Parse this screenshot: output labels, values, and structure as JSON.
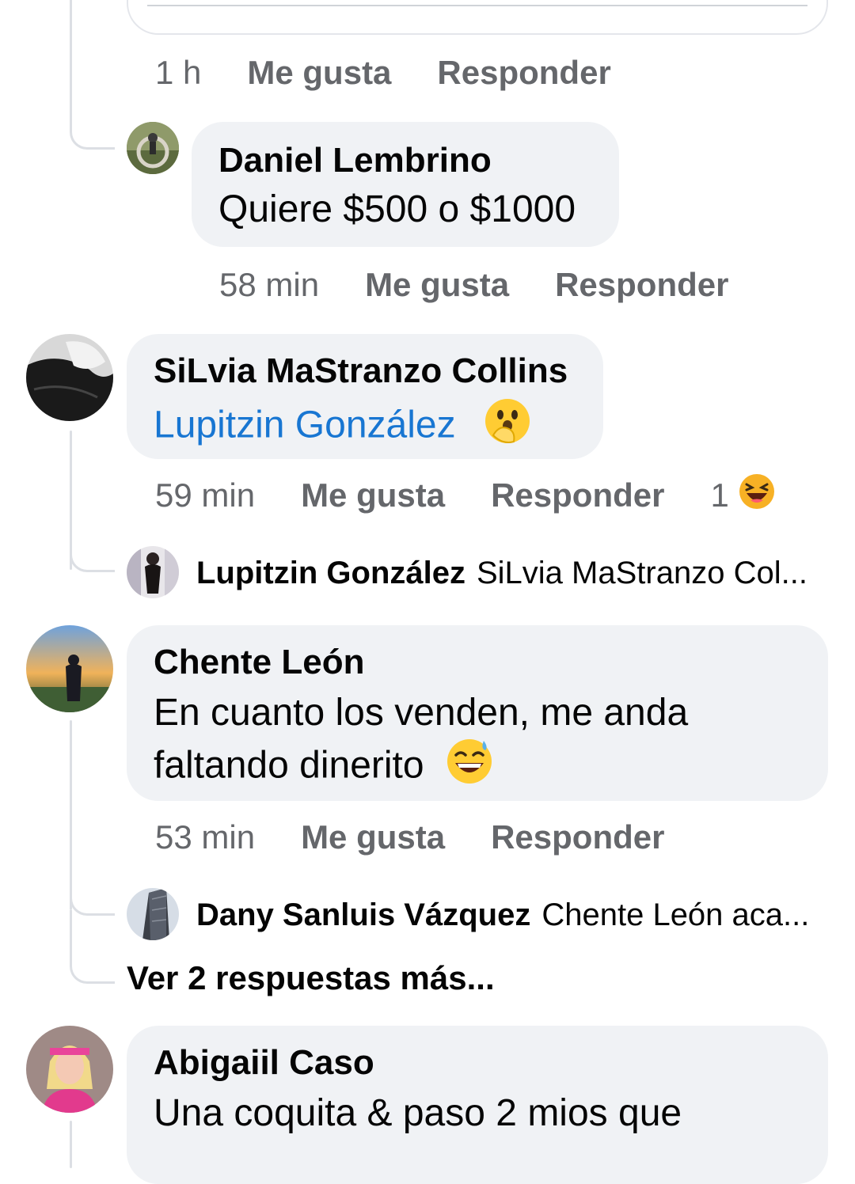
{
  "top_action_row": {
    "time": "1 h",
    "like": "Me gusta",
    "reply": "Responder"
  },
  "comments": [
    {
      "author": "Daniel Lembrino",
      "text": "Quiere $500 o $1000",
      "time": "58 min",
      "like": "Me gusta",
      "reply": "Responder",
      "avatar_icon": "person-avatar"
    },
    {
      "author": "SiLvia MaStranzo Collins",
      "mention": "Lupitzin González",
      "emoji_icon": "face-with-open-eyes-and-hand-over-mouth-icon",
      "time": "59 min",
      "like": "Me gusta",
      "reply": "Responder",
      "reaction_count": "1",
      "reaction_icon": "haha-reaction-icon",
      "avatar_icon": "person-avatar",
      "reply_preview": {
        "author": "Lupitzin González",
        "text": "SiLvia MaStranzo Col..."
      }
    },
    {
      "author": "Chente León",
      "text_line1": "En cuanto los venden, me anda",
      "text_line2": "faltando dinerito",
      "emoji_icon": "grinning-face-with-sweat-icon",
      "time": "53 min",
      "like": "Me gusta",
      "reply": "Responder",
      "avatar_icon": "person-avatar",
      "reply_preview": {
        "author": "Dany Sanluis Vázquez",
        "text": "Chente León aca..."
      },
      "more_replies": "Ver 2 respuestas más..."
    },
    {
      "author": "Abigaiil Caso",
      "text": "Una coquita & paso 2 mios que",
      "avatar_icon": "person-avatar"
    }
  ],
  "colors": {
    "bubble": "#f0f2f5",
    "meta_text": "#65676b",
    "mention": "#1876d2",
    "thread_line": "#dcdfe4"
  }
}
